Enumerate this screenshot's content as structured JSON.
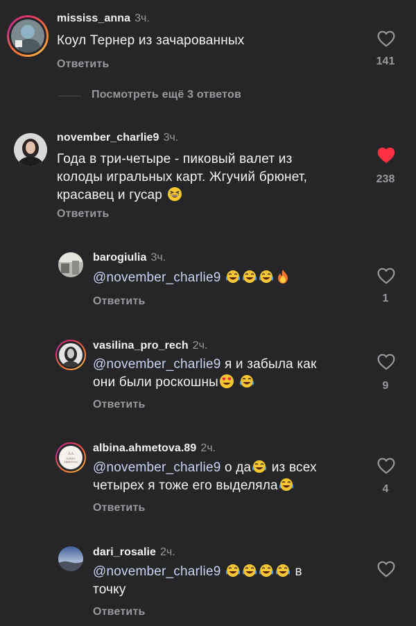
{
  "reply_label": "Ответить",
  "view_more": "Посмотреть ещё 3 ответов",
  "comments": [
    {
      "username": "mississ_anna",
      "time": "3ч.",
      "text": "Коул Тернер из зачарованных",
      "likes": "141",
      "liked": false,
      "avatar": "photo-person-blue-hair",
      "story_ring": true
    },
    {
      "username": "november_charlie9",
      "time": "3ч.",
      "text_lines": [
        "Года в три-четыре - пиковый валет из",
        "колоды игральных карт. Жгучий брюнет,",
        "красавец и гусар"
      ],
      "emojis": [
        "grinning-squinting-face"
      ],
      "likes": "238",
      "liked": true,
      "avatar": "photo-woman-dark-hair"
    },
    {
      "username": "barogiulia",
      "time": "3ч.",
      "mention": "@november_charlie9",
      "emojis": [
        "tears-of-joy-face",
        "tears-of-joy-face",
        "tears-of-joy-face",
        "fire"
      ],
      "likes": "1",
      "liked": false,
      "avatar": "photo-interior"
    },
    {
      "username": "vasilina_pro_rech",
      "time": "2ч.",
      "mention": "@november_charlie9",
      "text_lines": [
        " я и забыла как",
        "они были роскошны"
      ],
      "emojis": [
        "heart-eyes-face",
        "tears-of-joy-face"
      ],
      "likes": "9",
      "liked": false,
      "avatar": "photo-woman-bw",
      "story_ring": true
    },
    {
      "username": "albina.ahmetova.89",
      "time": "2ч.",
      "mention": "@november_charlie9",
      "text_lines": [
        " о да",
        " из всех",
        "четырех я тоже его выделяла"
      ],
      "emojis": [
        "tears-of-joy-face",
        "tears-of-joy-face"
      ],
      "likes": "4",
      "liked": false,
      "avatar": "logo-albina-ahmetova",
      "avatar_text": "ALBINA AHMETOVA",
      "story_ring": true
    },
    {
      "username": "dari_rosalie",
      "time": "2ч.",
      "mention": "@november_charlie9",
      "text_lines": [
        "в",
        "точку"
      ],
      "emojis": [
        "tears-of-joy-face",
        "tears-of-joy-face",
        "tears-of-joy-face",
        "tears-of-joy-face"
      ],
      "liked": false,
      "avatar": "photo-sky-landscape"
    }
  ],
  "colors": {
    "background": "#262628",
    "liked_heart": "#ff3040",
    "muted": "#9a9a9e",
    "mention": "#c9d4f2"
  }
}
